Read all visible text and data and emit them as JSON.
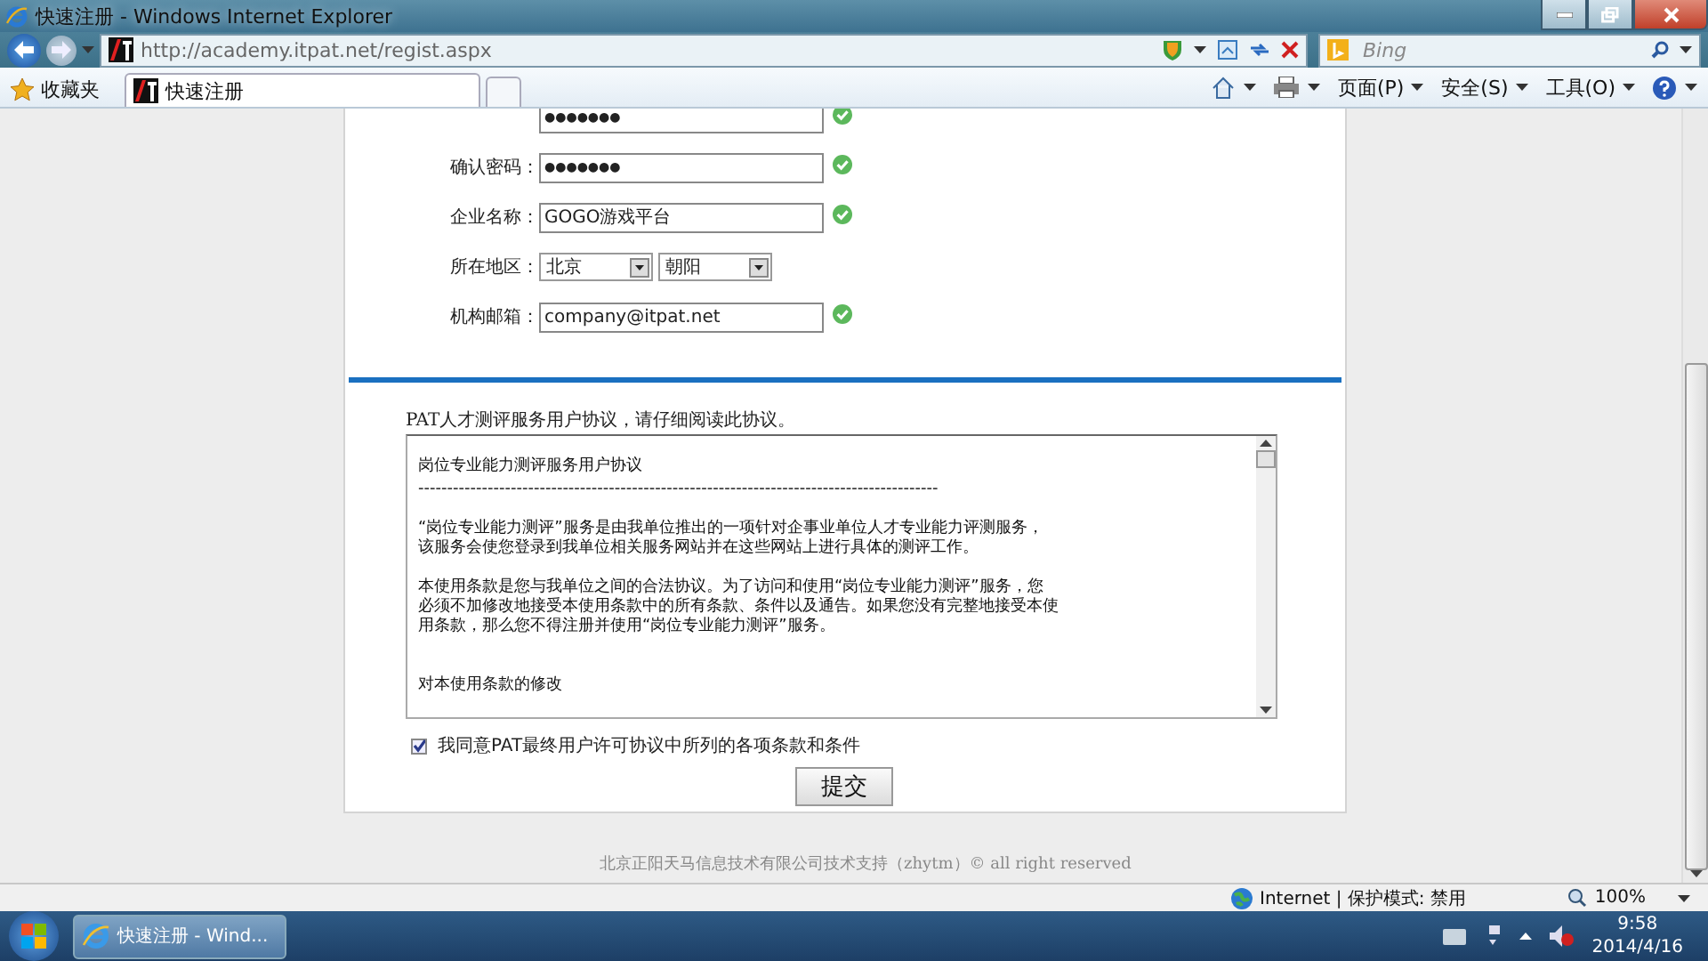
{
  "window": {
    "title": "快速注册 - Windows Internet Explorer"
  },
  "address_bar": {
    "url": "http://academy.itpat.net/regist.aspx"
  },
  "search": {
    "placeholder": "Bing"
  },
  "favorites": {
    "label": "收藏夹"
  },
  "tabs": [
    {
      "label": "快速注册",
      "selected": true
    }
  ],
  "commands": [
    "页面(P)",
    "安全(S)",
    "工具(O)"
  ],
  "form": {
    "fields": [
      {
        "kind": "password",
        "value": "●●●●●●●",
        "valid": true
      },
      {
        "label": "确认密码：",
        "kind": "password",
        "value": "●●●●●●●",
        "valid": true
      },
      {
        "label": "企业名称：",
        "kind": "text",
        "value": "GOGO游戏平台",
        "valid": true
      },
      {
        "label": "所在地区：",
        "kind": "select",
        "values": [
          "北京",
          "朝阳"
        ],
        "valid": false
      },
      {
        "label": "机构邮箱：",
        "kind": "text",
        "value": "company@itpat.net",
        "valid": true
      }
    ]
  },
  "agreement": {
    "caption": "PAT人才测评服务用户协议，请仔细阅读此协议。",
    "paragraphs": [
      {
        "lines": [
          "岗位专业能力测评服务用户协议",
          "------------------------------------------------------------------------------------------"
        ]
      },
      {
        "lines": [
          "“岗位专业能力测评”服务是由我单位推出的一项针对企事业单位人才专业能力评测服务，",
          "该服务会使您登录到我单位相关服务网站并在这些网站上进行具体的测评工作。"
        ]
      },
      {
        "lines": [
          "本使用条款是您与我单位之间的合法协议。为了访问和使用“岗位专业能力测评”服务，您",
          "必须不加修改地接受本使用条款中的所有条款、条件以及通告。如果您没有完整地接受本使",
          "用条款，那么您不得注册并使用“岗位专业能力测评”服务。"
        ]
      },
      {
        "lines": [
          "对本使用条款的修改"
        ]
      }
    ],
    "consent": {
      "label": "我同意PAT最终用户许可协议中所列的各项条款和条件",
      "checked": true
    },
    "submit": "提交"
  },
  "footer": {
    "text": "北京正阳天马信息技术有限公司技术支持（zhytm）© all right reserved"
  },
  "status_bar": {
    "zone": "Internet | 保护模式: 禁用",
    "zoom": "100%"
  },
  "taskbar": {
    "tasks": [
      {
        "label": "快速注册 - Wind...",
        "selected": true
      }
    ],
    "time": "9:58",
    "date": "2014/4/16"
  }
}
